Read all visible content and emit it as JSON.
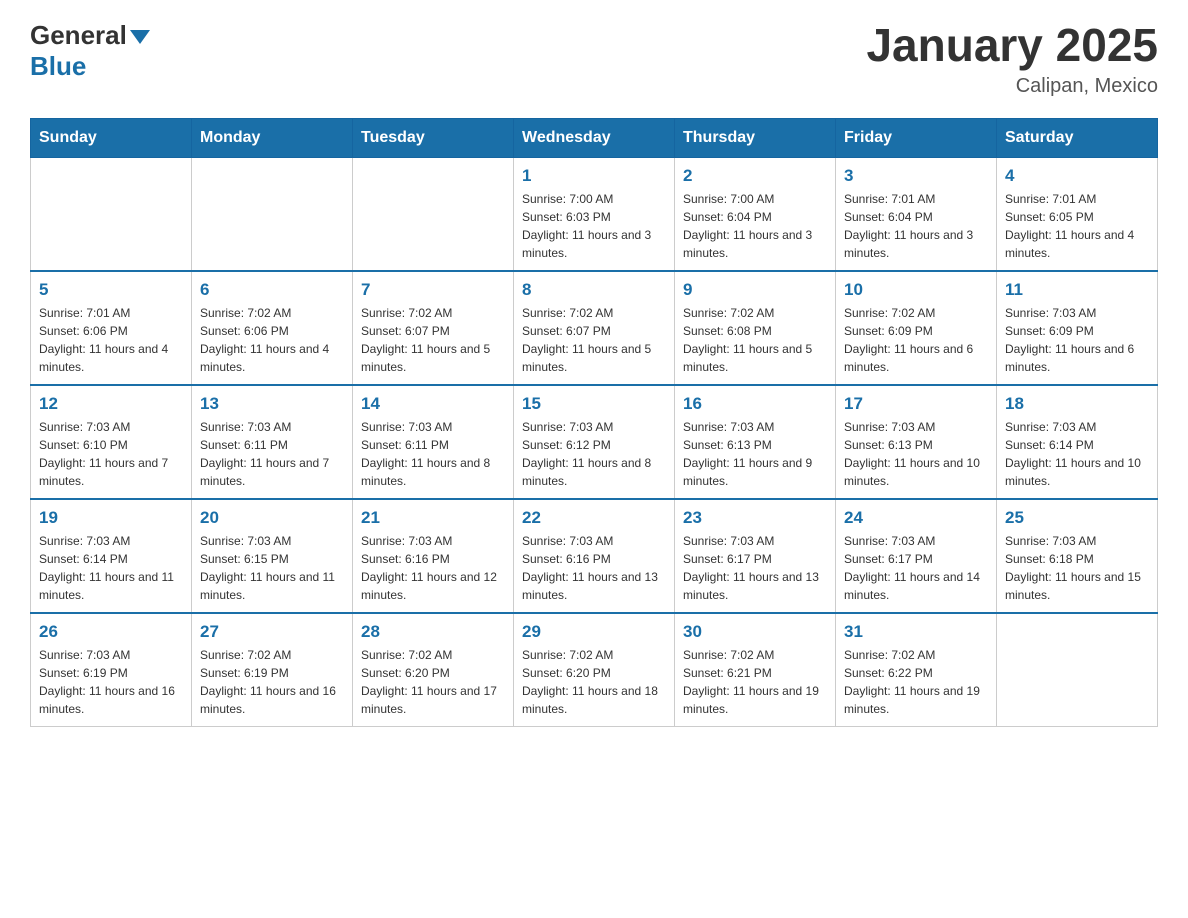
{
  "header": {
    "logo": {
      "general": "General",
      "blue": "Blue"
    },
    "title": "January 2025",
    "subtitle": "Calipan, Mexico"
  },
  "calendar": {
    "days_of_week": [
      "Sunday",
      "Monday",
      "Tuesday",
      "Wednesday",
      "Thursday",
      "Friday",
      "Saturday"
    ],
    "weeks": [
      [
        {
          "day": "",
          "info": ""
        },
        {
          "day": "",
          "info": ""
        },
        {
          "day": "",
          "info": ""
        },
        {
          "day": "1",
          "info": "Sunrise: 7:00 AM\nSunset: 6:03 PM\nDaylight: 11 hours and 3 minutes."
        },
        {
          "day": "2",
          "info": "Sunrise: 7:00 AM\nSunset: 6:04 PM\nDaylight: 11 hours and 3 minutes."
        },
        {
          "day": "3",
          "info": "Sunrise: 7:01 AM\nSunset: 6:04 PM\nDaylight: 11 hours and 3 minutes."
        },
        {
          "day": "4",
          "info": "Sunrise: 7:01 AM\nSunset: 6:05 PM\nDaylight: 11 hours and 4 minutes."
        }
      ],
      [
        {
          "day": "5",
          "info": "Sunrise: 7:01 AM\nSunset: 6:06 PM\nDaylight: 11 hours and 4 minutes."
        },
        {
          "day": "6",
          "info": "Sunrise: 7:02 AM\nSunset: 6:06 PM\nDaylight: 11 hours and 4 minutes."
        },
        {
          "day": "7",
          "info": "Sunrise: 7:02 AM\nSunset: 6:07 PM\nDaylight: 11 hours and 5 minutes."
        },
        {
          "day": "8",
          "info": "Sunrise: 7:02 AM\nSunset: 6:07 PM\nDaylight: 11 hours and 5 minutes."
        },
        {
          "day": "9",
          "info": "Sunrise: 7:02 AM\nSunset: 6:08 PM\nDaylight: 11 hours and 5 minutes."
        },
        {
          "day": "10",
          "info": "Sunrise: 7:02 AM\nSunset: 6:09 PM\nDaylight: 11 hours and 6 minutes."
        },
        {
          "day": "11",
          "info": "Sunrise: 7:03 AM\nSunset: 6:09 PM\nDaylight: 11 hours and 6 minutes."
        }
      ],
      [
        {
          "day": "12",
          "info": "Sunrise: 7:03 AM\nSunset: 6:10 PM\nDaylight: 11 hours and 7 minutes."
        },
        {
          "day": "13",
          "info": "Sunrise: 7:03 AM\nSunset: 6:11 PM\nDaylight: 11 hours and 7 minutes."
        },
        {
          "day": "14",
          "info": "Sunrise: 7:03 AM\nSunset: 6:11 PM\nDaylight: 11 hours and 8 minutes."
        },
        {
          "day": "15",
          "info": "Sunrise: 7:03 AM\nSunset: 6:12 PM\nDaylight: 11 hours and 8 minutes."
        },
        {
          "day": "16",
          "info": "Sunrise: 7:03 AM\nSunset: 6:13 PM\nDaylight: 11 hours and 9 minutes."
        },
        {
          "day": "17",
          "info": "Sunrise: 7:03 AM\nSunset: 6:13 PM\nDaylight: 11 hours and 10 minutes."
        },
        {
          "day": "18",
          "info": "Sunrise: 7:03 AM\nSunset: 6:14 PM\nDaylight: 11 hours and 10 minutes."
        }
      ],
      [
        {
          "day": "19",
          "info": "Sunrise: 7:03 AM\nSunset: 6:14 PM\nDaylight: 11 hours and 11 minutes."
        },
        {
          "day": "20",
          "info": "Sunrise: 7:03 AM\nSunset: 6:15 PM\nDaylight: 11 hours and 11 minutes."
        },
        {
          "day": "21",
          "info": "Sunrise: 7:03 AM\nSunset: 6:16 PM\nDaylight: 11 hours and 12 minutes."
        },
        {
          "day": "22",
          "info": "Sunrise: 7:03 AM\nSunset: 6:16 PM\nDaylight: 11 hours and 13 minutes."
        },
        {
          "day": "23",
          "info": "Sunrise: 7:03 AM\nSunset: 6:17 PM\nDaylight: 11 hours and 13 minutes."
        },
        {
          "day": "24",
          "info": "Sunrise: 7:03 AM\nSunset: 6:17 PM\nDaylight: 11 hours and 14 minutes."
        },
        {
          "day": "25",
          "info": "Sunrise: 7:03 AM\nSunset: 6:18 PM\nDaylight: 11 hours and 15 minutes."
        }
      ],
      [
        {
          "day": "26",
          "info": "Sunrise: 7:03 AM\nSunset: 6:19 PM\nDaylight: 11 hours and 16 minutes."
        },
        {
          "day": "27",
          "info": "Sunrise: 7:02 AM\nSunset: 6:19 PM\nDaylight: 11 hours and 16 minutes."
        },
        {
          "day": "28",
          "info": "Sunrise: 7:02 AM\nSunset: 6:20 PM\nDaylight: 11 hours and 17 minutes."
        },
        {
          "day": "29",
          "info": "Sunrise: 7:02 AM\nSunset: 6:20 PM\nDaylight: 11 hours and 18 minutes."
        },
        {
          "day": "30",
          "info": "Sunrise: 7:02 AM\nSunset: 6:21 PM\nDaylight: 11 hours and 19 minutes."
        },
        {
          "day": "31",
          "info": "Sunrise: 7:02 AM\nSunset: 6:22 PM\nDaylight: 11 hours and 19 minutes."
        },
        {
          "day": "",
          "info": ""
        }
      ]
    ]
  }
}
